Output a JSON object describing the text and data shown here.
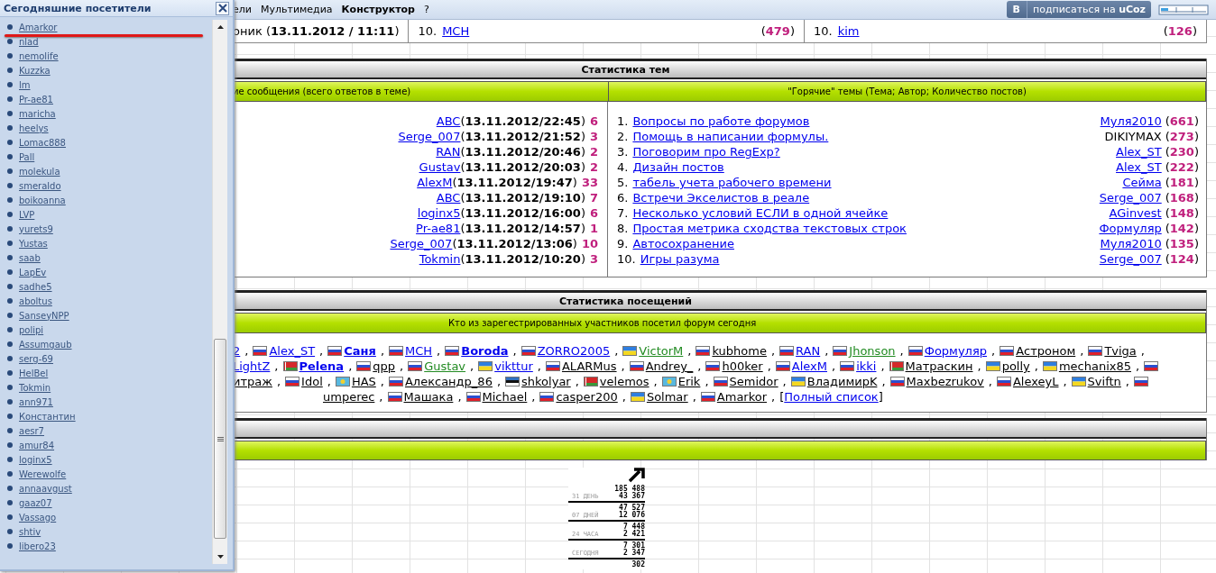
{
  "top_menu": [
    {
      "label": "ели",
      "bold": false
    },
    {
      "label": "Мультимедиа",
      "bold": false
    },
    {
      "label": "Конструктор",
      "bold": true
    },
    {
      "label": "?",
      "bold": false
    }
  ],
  "subscribe_button": {
    "badge": "В",
    "label": "подписаться на **uCoz**"
  },
  "panel": {
    "title": "Сегодняшние посетители",
    "users": [
      "Amarkor",
      "nlad",
      "nemolife",
      "Kuzzka",
      "lm",
      "Pr-ae81",
      "maricha",
      "heelys",
      "Lomac888",
      "Pall",
      "molekula",
      "smeraldo",
      "boikoanna",
      "LVP",
      "yurets9",
      "Yustas",
      "saab",
      "LapEv",
      "sadhe5",
      "aboltus",
      "SanseyNPP",
      "polipi",
      "Assumgaub",
      "serg-69",
      "HelBel",
      "Tokmin",
      "ann971",
      "Константин",
      "aesr7",
      "amur84",
      "loginx5",
      "Werewolfe",
      "annaavgust",
      "gaaz07",
      "Vassago",
      "shtiv",
      "libero23"
    ]
  },
  "top_row": [
    {
      "kind": "text",
      "text": "оник (**13.11.2012 / 11:11**)"
    },
    {
      "kind": "ranked",
      "rank": "10.",
      "name": "MCH",
      "count": "(**479**)"
    },
    {
      "kind": "ranked",
      "rank": "10.",
      "name": "kim",
      "count": "(**126**)"
    }
  ],
  "topic_stats": {
    "title": "Статистика тем",
    "headers": [
      "ие сообщения (всего ответов в теме)",
      "\"Горячие\" темы (Тема; Автор; Количество постов)"
    ],
    "recent": [
      {
        "author": "ABC",
        "time": "(**13.11.2012/22:45**)",
        "replies": "6"
      },
      {
        "author": "Serge_007",
        "time": "(**13.11.2012/21:52**)",
        "replies": "3"
      },
      {
        "author": "RAN",
        "time": "(**13.11.2012/20:46**)",
        "replies": "2"
      },
      {
        "author": "Gustav",
        "time": "(**13.11.2012/20:03**)",
        "replies": "2"
      },
      {
        "author": "AlexM",
        "time": "(**13.11.2012/19:47**)",
        "replies": "33"
      },
      {
        "author": "ABC",
        "time": "(**13.11.2012/19:10**)",
        "replies": "7"
      },
      {
        "author": "loginx5",
        "time": "(**13.11.2012/16:00**)",
        "replies": "6"
      },
      {
        "author": "Pr-ae81",
        "time": "(**13.11.2012/14:57**)",
        "replies": "1"
      },
      {
        "author": "Serge_007",
        "time": "(**13.11.2012/13:06**)",
        "replies": "10"
      },
      {
        "author": "Tokmin",
        "time": "(**13.11.2012/10:20**)",
        "replies": "3"
      }
    ],
    "hot": [
      {
        "rank": "1.",
        "title": "Вопросы по работе форумов",
        "author": "Муля2010",
        "author_link": true,
        "posts": "(**661**)"
      },
      {
        "rank": "2.",
        "title": "Помощь в написании формулы.",
        "author": "DIKIYMAX",
        "author_link": false,
        "posts": "(**273**)"
      },
      {
        "rank": "3.",
        "title": "Поговорим про RegExp?",
        "author": "Alex_ST",
        "author_link": true,
        "posts": "(**230**)"
      },
      {
        "rank": "4.",
        "title": "Дизайн постов",
        "author": "Alex_ST",
        "author_link": true,
        "posts": "(**222**)"
      },
      {
        "rank": "5.",
        "title": "табель учета рабочего времени",
        "author": "Сейма",
        "author_link": true,
        "posts": "(**181**)"
      },
      {
        "rank": "6.",
        "title": "Встречи Экселистов в реале",
        "author": "Serge_007",
        "author_link": true,
        "posts": "(**168**)"
      },
      {
        "rank": "7.",
        "title": "Несколько условий ЕСЛИ в одной ячейке",
        "author": "AGinvest",
        "author_link": true,
        "posts": "(**148**)"
      },
      {
        "rank": "8.",
        "title": "Простая метрика сходства текстовых строк",
        "author": "Формуляр",
        "author_link": true,
        "posts": "(**142**)"
      },
      {
        "rank": "9.",
        "title": "Автосохранение",
        "author": "Муля2010",
        "author_link": true,
        "posts": "(**135**)"
      },
      {
        "rank": "10.",
        "title": "Игры разума",
        "author": "Serge_007",
        "author_link": true,
        "posts": "(**124**)"
      }
    ]
  },
  "visit_stats": {
    "title": "Статистика посещений",
    "header": "Кто из зарегестрированных участников посетил форум сегодня",
    "separator": ",",
    "lines": [
      {
        "users": [
          {
            "name": "2",
            "kind": "blue"
          },
          {
            "name": "Alex_ST",
            "flag": {
              "kind": "ru"
            },
            "kind": "blue"
          },
          {
            "name": "Саня",
            "flag": {
              "kind": "ru"
            },
            "kind": "bold"
          },
          {
            "name": "MCH",
            "flag": {
              "kind": "ru"
            },
            "kind": "blue"
          },
          {
            "name": "Boroda",
            "flag": {
              "kind": "ru"
            },
            "kind": "bold"
          },
          {
            "name": "ZORRO2005",
            "flag": {
              "kind": "ru"
            },
            "kind": "blue"
          },
          {
            "name": "VictorM",
            "flag": {
              "kind": "ua"
            },
            "kind": "green"
          },
          {
            "name": "kubhome",
            "flag": {
              "kind": "ru"
            },
            "kind": "plain"
          },
          {
            "name": "RAN",
            "flag": {
              "kind": "ru"
            },
            "kind": "blue"
          },
          {
            "name": "Jhonson",
            "flag": {
              "kind": "ru"
            },
            "kind": "green"
          },
          {
            "name": "Формуляр",
            "flag": {
              "kind": "ru"
            },
            "kind": "blue"
          },
          {
            "name": "Астроном",
            "flag": {
              "kind": "ru"
            },
            "kind": "plain"
          },
          {
            "name": "Tviga",
            "flag": {
              "kind": "ru"
            },
            "kind": "plain"
          }
        ]
      },
      {
        "users": [
          {
            "name": "LightZ",
            "kind": "blue"
          },
          {
            "name": "Pelena",
            "flag": {
              "kind": "by"
            },
            "kind": "bold"
          },
          {
            "name": "qpp",
            "flag": {
              "kind": "ru"
            },
            "kind": "plain"
          },
          {
            "name": "Gustav",
            "flag": {
              "kind": "ru"
            },
            "kind": "green"
          },
          {
            "name": "vikttur",
            "flag": {
              "kind": "ua"
            },
            "kind": "blue"
          },
          {
            "name": "ALARMus",
            "flag": {
              "kind": "ru"
            },
            "kind": "plain"
          },
          {
            "name": "Andrey_",
            "flag": {
              "kind": "ru"
            },
            "kind": "plain"
          },
          {
            "name": "h00ker",
            "flag": {
              "kind": "ru"
            },
            "kind": "plain"
          },
          {
            "name": "AlexM",
            "flag": {
              "kind": "ru"
            },
            "kind": "blue"
          },
          {
            "name": "ikki",
            "flag": {
              "kind": "ru"
            },
            "kind": "blue"
          },
          {
            "name": "Матраскин",
            "flag": {
              "kind": "by"
            },
            "kind": "plain"
          },
          {
            "name": "polly",
            "flag": {
              "kind": "ua"
            },
            "kind": "plain"
          },
          {
            "name": "mechanix85",
            "flag": {
              "kind": "ua"
            },
            "kind": "plain"
          },
          {
            "flag": {
              "kind": "ru"
            },
            "kind": "plain"
          }
        ]
      },
      {
        "users": [
          {
            "name": "итраж",
            "kind": "plain"
          },
          {
            "name": "Idol",
            "flag": {
              "kind": "ru"
            },
            "kind": "plain"
          },
          {
            "name": "HAS",
            "flag": {
              "kind": "kz"
            },
            "kind": "plain"
          },
          {
            "name": "Александр_86",
            "flag": {
              "kind": "ru"
            },
            "kind": "plain"
          },
          {
            "name": "shkolyar",
            "flag": {
              "kind": "ee"
            },
            "kind": "plain"
          },
          {
            "name": "velemos",
            "flag": {
              "kind": "by"
            },
            "kind": "plain"
          },
          {
            "name": "Erik",
            "flag": {
              "kind": "kz"
            },
            "kind": "plain"
          },
          {
            "name": "Semidor",
            "flag": {
              "kind": "ru"
            },
            "kind": "plain"
          },
          {
            "name": "ВладимирK",
            "flag": {
              "kind": "ua"
            },
            "kind": "plain"
          },
          {
            "name": "Maxbezrukov",
            "flag": {
              "kind": "ru"
            },
            "kind": "plain"
          },
          {
            "name": "AlexeyL",
            "flag": {
              "kind": "ru"
            },
            "kind": "plain"
          },
          {
            "name": "Sviftn",
            "flag": {
              "kind": "ua"
            },
            "kind": "plain"
          },
          {
            "flag": {
              "kind": "ru"
            },
            "kind": "plain"
          }
        ]
      },
      {
        "users": [
          {
            "name": "umperec",
            "kind": "plain"
          },
          {
            "name": "Машака",
            "flag": {
              "kind": "ru"
            },
            "kind": "plain"
          },
          {
            "name": "Michael",
            "flag": {
              "kind": "ru"
            },
            "kind": "plain"
          },
          {
            "name": "casper200",
            "flag": {
              "kind": "ru"
            },
            "kind": "plain"
          },
          {
            "name": "Solmar",
            "flag": {
              "kind": "ua"
            },
            "kind": "plain"
          },
          {
            "name": "Amarkor",
            "flag": {
              "kind": "ru"
            },
            "kind": "plain"
          }
        ]
      }
    ],
    "full_list": {
      "open": "[",
      "link": "Полный список",
      "close": "]"
    }
  },
  "counter": {
    "rows": [
      {
        "values": [
          "185 488",
          "43 367"
        ],
        "label": "31 ДЕНЬ"
      },
      {
        "values": [
          "47 527",
          "12 076"
        ],
        "label": "07 ДНЕЙ"
      },
      {
        "values": [
          "7 448",
          "2 421"
        ],
        "label": "24 ЧАСА"
      },
      {
        "values": [
          "7 301",
          "2 347"
        ],
        "label": "СЕГОДНЯ"
      },
      {
        "values": [
          "302"
        ]
      }
    ]
  }
}
